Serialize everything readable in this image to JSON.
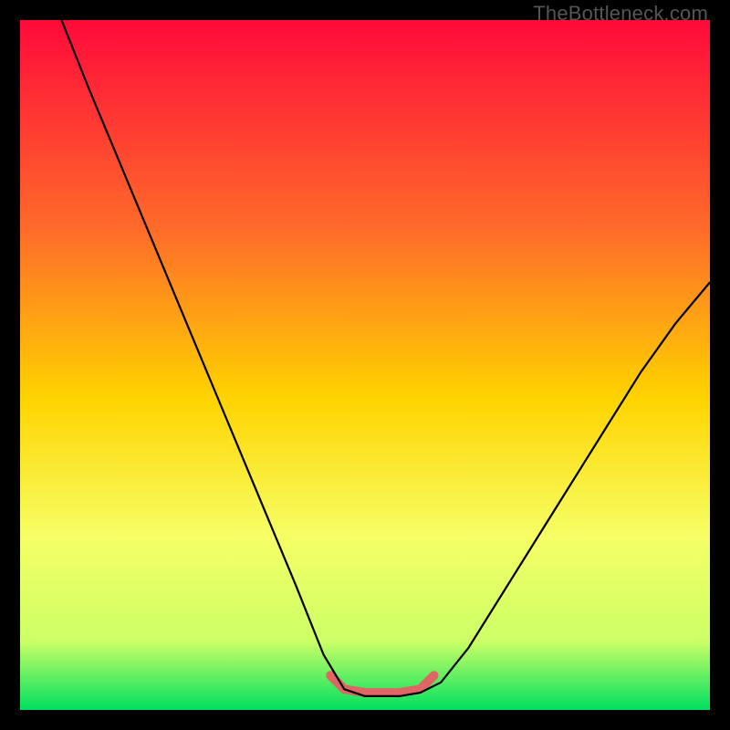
{
  "watermark": "TheBottleneck.com",
  "chart_data": {
    "type": "line",
    "title": "",
    "xlabel": "",
    "ylabel": "",
    "xlim": [
      0,
      100
    ],
    "ylim": [
      0,
      100
    ],
    "gradient_stops": [
      {
        "offset": 0,
        "color": "#ff0a3a"
      },
      {
        "offset": 30,
        "color": "#ff6a2a"
      },
      {
        "offset": 55,
        "color": "#ffd400"
      },
      {
        "offset": 75,
        "color": "#f6ff66"
      },
      {
        "offset": 90,
        "color": "#ccff66"
      },
      {
        "offset": 100,
        "color": "#00e060"
      }
    ],
    "series": [
      {
        "name": "bottleneck-curve",
        "color": "#000000",
        "points": [
          {
            "x": 6.0,
            "y": 100.0
          },
          {
            "x": 10.0,
            "y": 90.0
          },
          {
            "x": 15.0,
            "y": 78.0
          },
          {
            "x": 20.0,
            "y": 66.0
          },
          {
            "x": 25.0,
            "y": 54.0
          },
          {
            "x": 30.0,
            "y": 42.0
          },
          {
            "x": 35.0,
            "y": 30.0
          },
          {
            "x": 40.0,
            "y": 18.0
          },
          {
            "x": 44.0,
            "y": 8.0
          },
          {
            "x": 47.0,
            "y": 3.0
          },
          {
            "x": 50.0,
            "y": 2.0
          },
          {
            "x": 55.0,
            "y": 2.0
          },
          {
            "x": 58.0,
            "y": 2.5
          },
          {
            "x": 61.0,
            "y": 4.0
          },
          {
            "x": 65.0,
            "y": 9.0
          },
          {
            "x": 70.0,
            "y": 17.0
          },
          {
            "x": 75.0,
            "y": 25.0
          },
          {
            "x": 80.0,
            "y": 33.0
          },
          {
            "x": 85.0,
            "y": 41.0
          },
          {
            "x": 90.0,
            "y": 49.0
          },
          {
            "x": 95.0,
            "y": 56.0
          },
          {
            "x": 100.0,
            "y": 62.0
          }
        ]
      },
      {
        "name": "flat-band",
        "color": "#e06666",
        "stroke_width": 10,
        "points": [
          {
            "x": 45.0,
            "y": 5.0
          },
          {
            "x": 47.0,
            "y": 3.0
          },
          {
            "x": 50.0,
            "y": 2.5
          },
          {
            "x": 55.0,
            "y": 2.5
          },
          {
            "x": 58.0,
            "y": 3.0
          },
          {
            "x": 60.0,
            "y": 5.0
          }
        ]
      }
    ]
  }
}
